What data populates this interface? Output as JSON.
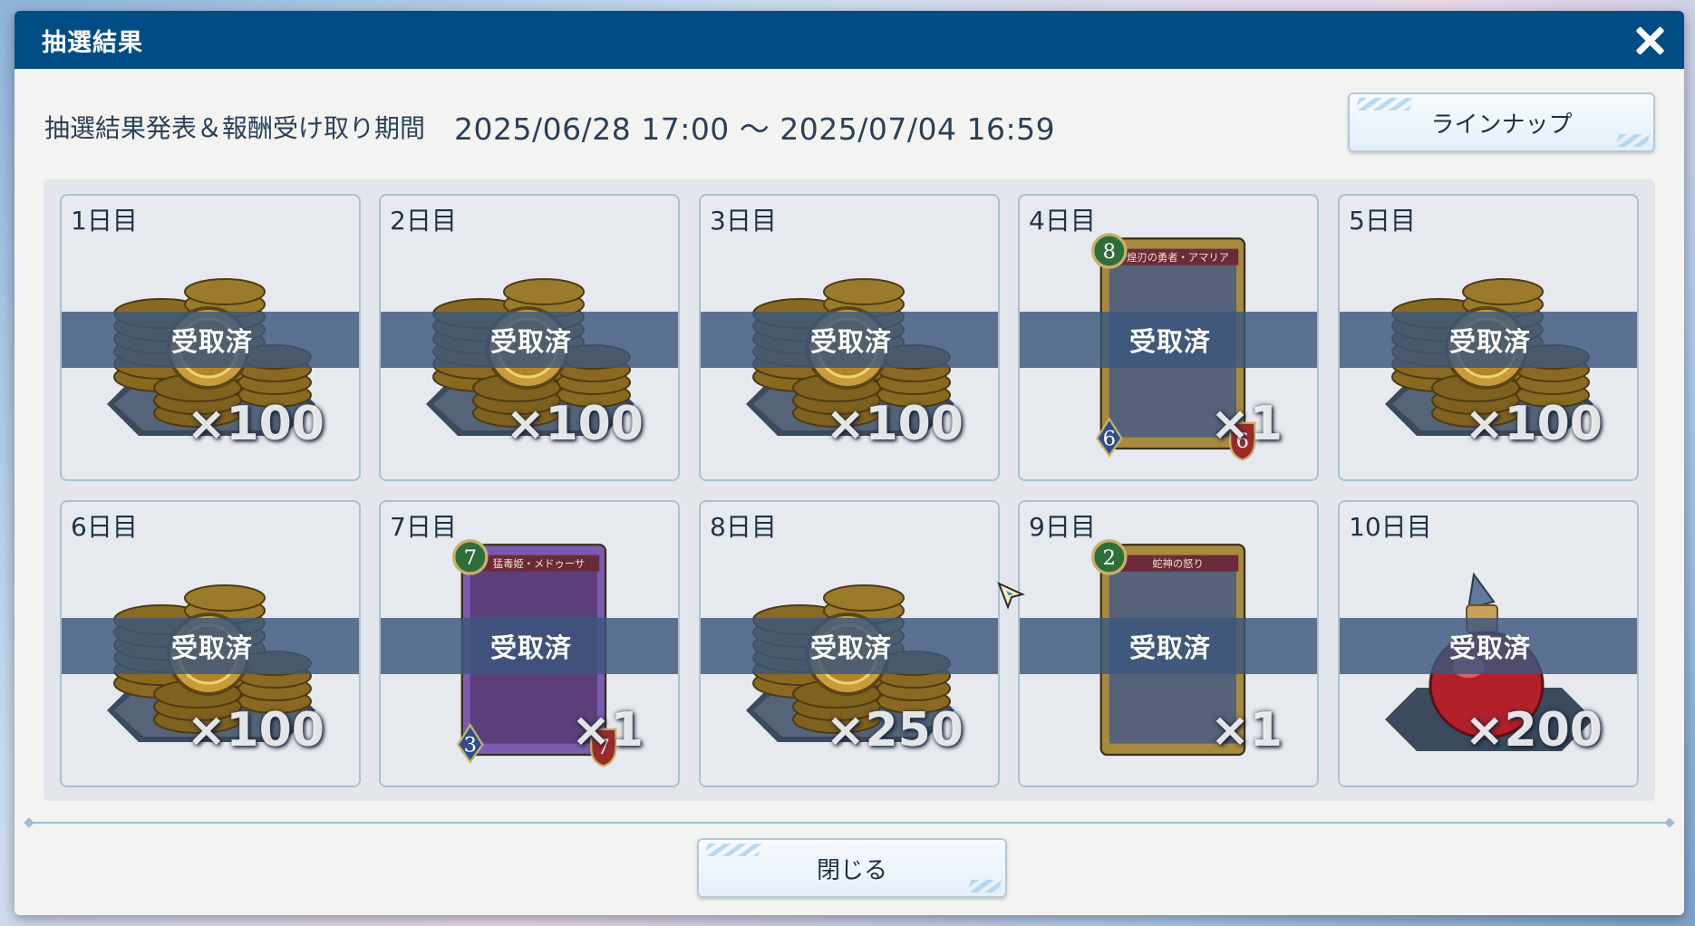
{
  "window": {
    "title": "抽選結果",
    "close_icon": "close-icon"
  },
  "period": {
    "label": "抽選結果発表＆報酬受け取り期間",
    "range": "2025/06/28 17:00 ～ 2025/07/04 16:59"
  },
  "lineup_button": "ラインナップ",
  "close_button": "閉じる",
  "claimed_label": "受取済",
  "days": [
    {
      "day": "1日目",
      "item": "coin-pile-icon",
      "qty": "×100"
    },
    {
      "day": "2日目",
      "item": "coin-pile-icon",
      "qty": "×100"
    },
    {
      "day": "3日目",
      "item": "coin-pile-icon",
      "qty": "×100"
    },
    {
      "day": "4日目",
      "item": "card-icon",
      "qty": "×1",
      "card": {
        "cost": "8",
        "name": "煌刃の勇者・アマリア",
        "attack": "6",
        "defense": "6"
      }
    },
    {
      "day": "5日目",
      "item": "coin-pile-icon",
      "qty": "×100"
    },
    {
      "day": "6日目",
      "item": "coin-pile-icon",
      "qty": "×100"
    },
    {
      "day": "7日目",
      "item": "card-icon",
      "qty": "×1",
      "card": {
        "cost": "7",
        "name": "猛毒姫・メドゥーサ",
        "attack": "3",
        "defense": "7"
      }
    },
    {
      "day": "8日目",
      "item": "coin-pile-icon",
      "qty": "×250"
    },
    {
      "day": "9日目",
      "item": "card-icon",
      "qty": "×1",
      "card": {
        "cost": "2",
        "name": "蛇神の怒り"
      }
    },
    {
      "day": "10日目",
      "item": "potion-icon",
      "qty": "×200"
    }
  ],
  "colors": {
    "header": "#004d86",
    "claimed_band": "#3a577d"
  }
}
